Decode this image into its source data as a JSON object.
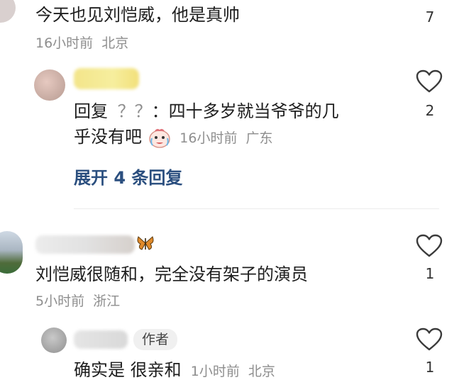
{
  "comments": [
    {
      "text": "今天也见刘恺威，他是真帅",
      "time": "16小时前",
      "location": "北京",
      "likes": "7"
    },
    {
      "reply_prefix": "回复",
      "reply_to": "？？",
      "text_line1": "：四十多岁就当爷爷的几",
      "text_line2": "乎没有吧",
      "time": "16小时前",
      "location": "广东",
      "likes": "2",
      "expand_label": "展开 4 条回复"
    },
    {
      "text": "刘恺威很随和，完全没有架子的演员",
      "time": "5小时前",
      "location": "浙江",
      "likes": "1"
    },
    {
      "badge": "作者",
      "text": "确实是 很亲和",
      "time": "1小时前",
      "location": "北京",
      "likes": "1"
    }
  ],
  "colors": {
    "link": "#2b4f7f",
    "meta": "#8e8e8e",
    "text": "#1e1e1e"
  }
}
